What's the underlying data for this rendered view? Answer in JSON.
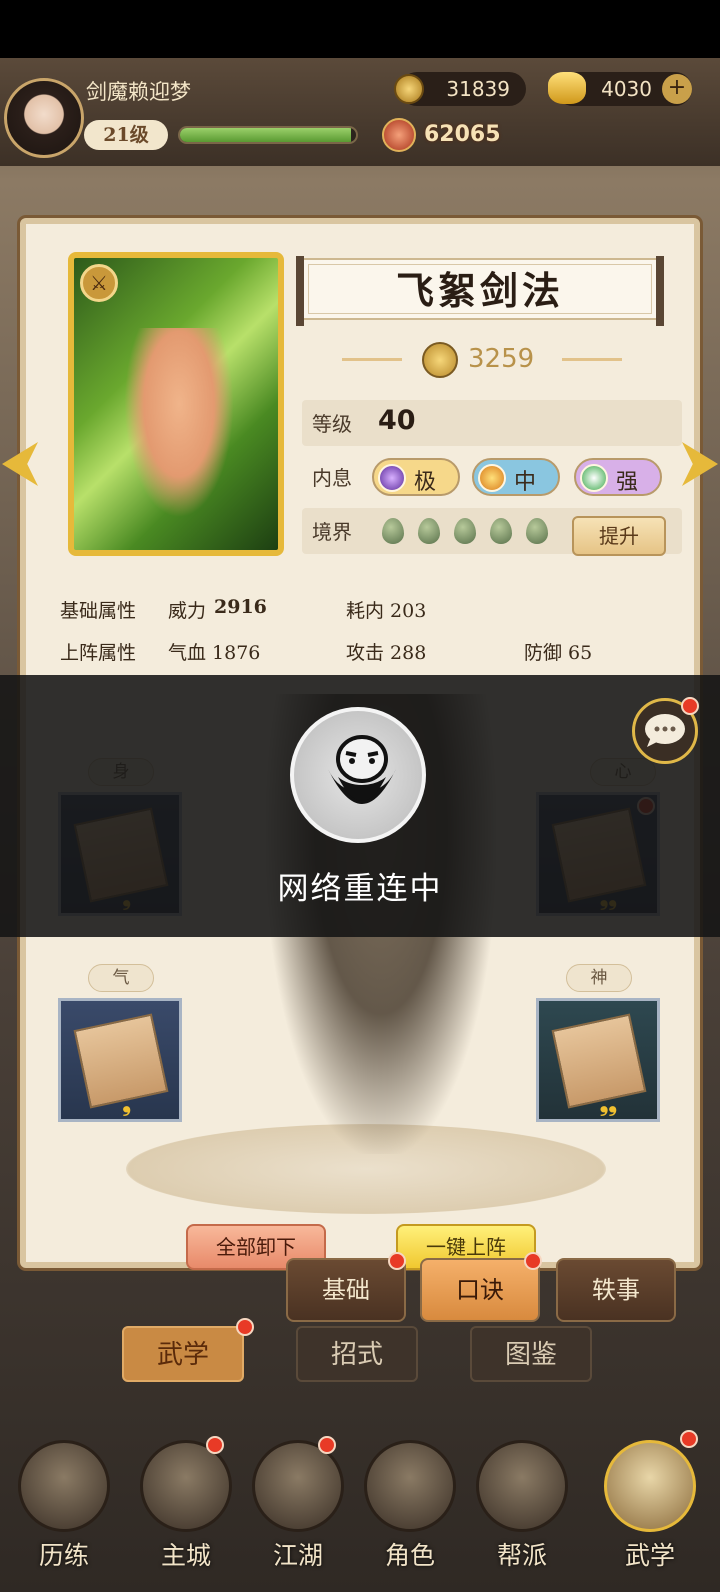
{
  "player": {
    "name": "剑魔赖迎梦",
    "level": "21级",
    "exp_progress": 0.97,
    "coins": "31839",
    "gold": "4030",
    "power": "62065"
  },
  "skill": {
    "title": "飞絮剑法",
    "power": "3259",
    "level_label": "等级",
    "level_value": "40",
    "inner_label": "内息",
    "grades": [
      "极",
      "中",
      "强"
    ],
    "realm_label": "境界",
    "realm_count": 5,
    "upgrade_label": "提升"
  },
  "attributes": {
    "base_label": "基础属性",
    "base_power_label": "威力",
    "base_power_value": "2916",
    "base_inner": "耗内 203",
    "deploy_label": "上阵属性",
    "deploy_hp": "气血 1876",
    "deploy_attack": "攻击 288",
    "deploy_defense": "防御 65"
  },
  "slots": {
    "body": "身",
    "heart": "心",
    "qi": "气",
    "spirit": "神"
  },
  "actions": {
    "unload_all": "全部卸下",
    "equip_one_key": "一键上阵"
  },
  "subtabs": [
    "基础",
    "口诀",
    "轶事"
  ],
  "tabs": [
    "武学",
    "招式",
    "图鉴"
  ],
  "nav": [
    "历练",
    "主城",
    "江湖",
    "角色",
    "帮派",
    "武学"
  ],
  "overlay": {
    "message": "网络重连中"
  },
  "colors": {
    "accent_gold": "#e6b93a",
    "notification_red": "#e83a26",
    "card_bg": "#f4ecdc"
  }
}
